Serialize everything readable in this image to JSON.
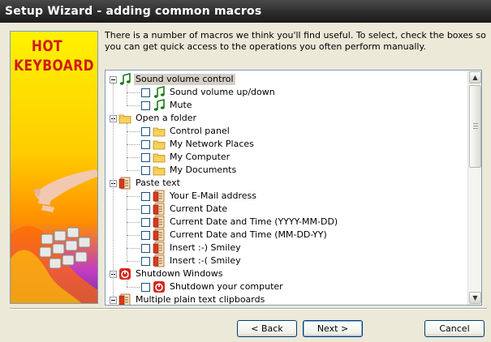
{
  "window": {
    "title": "Setup Wizard - adding common macros"
  },
  "banner": {
    "brand_line1": "HOT",
    "brand_line2": "KEYBOARD"
  },
  "intro": {
    "text": "There is a number of macros we think you'll find useful. To select, check the boxes so you can get quick access to the operations you often perform manually."
  },
  "tree": {
    "groups": [
      {
        "label": "Sound volume control",
        "icon": "music-note-icon",
        "selected": true,
        "items": [
          {
            "label": "Sound volume up/down",
            "icon": "music-note-icon"
          },
          {
            "label": "Mute",
            "icon": "music-note-icon"
          }
        ]
      },
      {
        "label": "Open a folder",
        "icon": "folder-icon",
        "items": [
          {
            "label": "Control panel",
            "icon": "folder-icon"
          },
          {
            "label": "My Network Places",
            "icon": "folder-icon"
          },
          {
            "label": "My Computer",
            "icon": "folder-icon"
          },
          {
            "label": "My Documents",
            "icon": "folder-icon"
          }
        ]
      },
      {
        "label": "Paste text",
        "icon": "paste-text-icon",
        "items": [
          {
            "label": "Your E-Mail address",
            "icon": "paste-text-icon"
          },
          {
            "label": "Current Date",
            "icon": "paste-text-icon"
          },
          {
            "label": "Current Date and Time (YYYY-MM-DD)",
            "icon": "paste-text-icon"
          },
          {
            "label": "Current Date and Time (MM-DD-YY)",
            "icon": "paste-text-icon"
          },
          {
            "label": "Insert :-) Smiley",
            "icon": "paste-text-icon"
          },
          {
            "label": "Insert :-( Smiley",
            "icon": "paste-text-icon"
          }
        ]
      },
      {
        "label": "Shutdown Windows",
        "icon": "power-icon",
        "items": [
          {
            "label": "Shutdown your computer",
            "icon": "power-icon"
          }
        ]
      },
      {
        "label": "Multiple plain text clipboards",
        "icon": "paste-text-icon",
        "items": []
      }
    ]
  },
  "buttons": {
    "back": "< Back",
    "next": "Next >",
    "cancel": "Cancel"
  }
}
